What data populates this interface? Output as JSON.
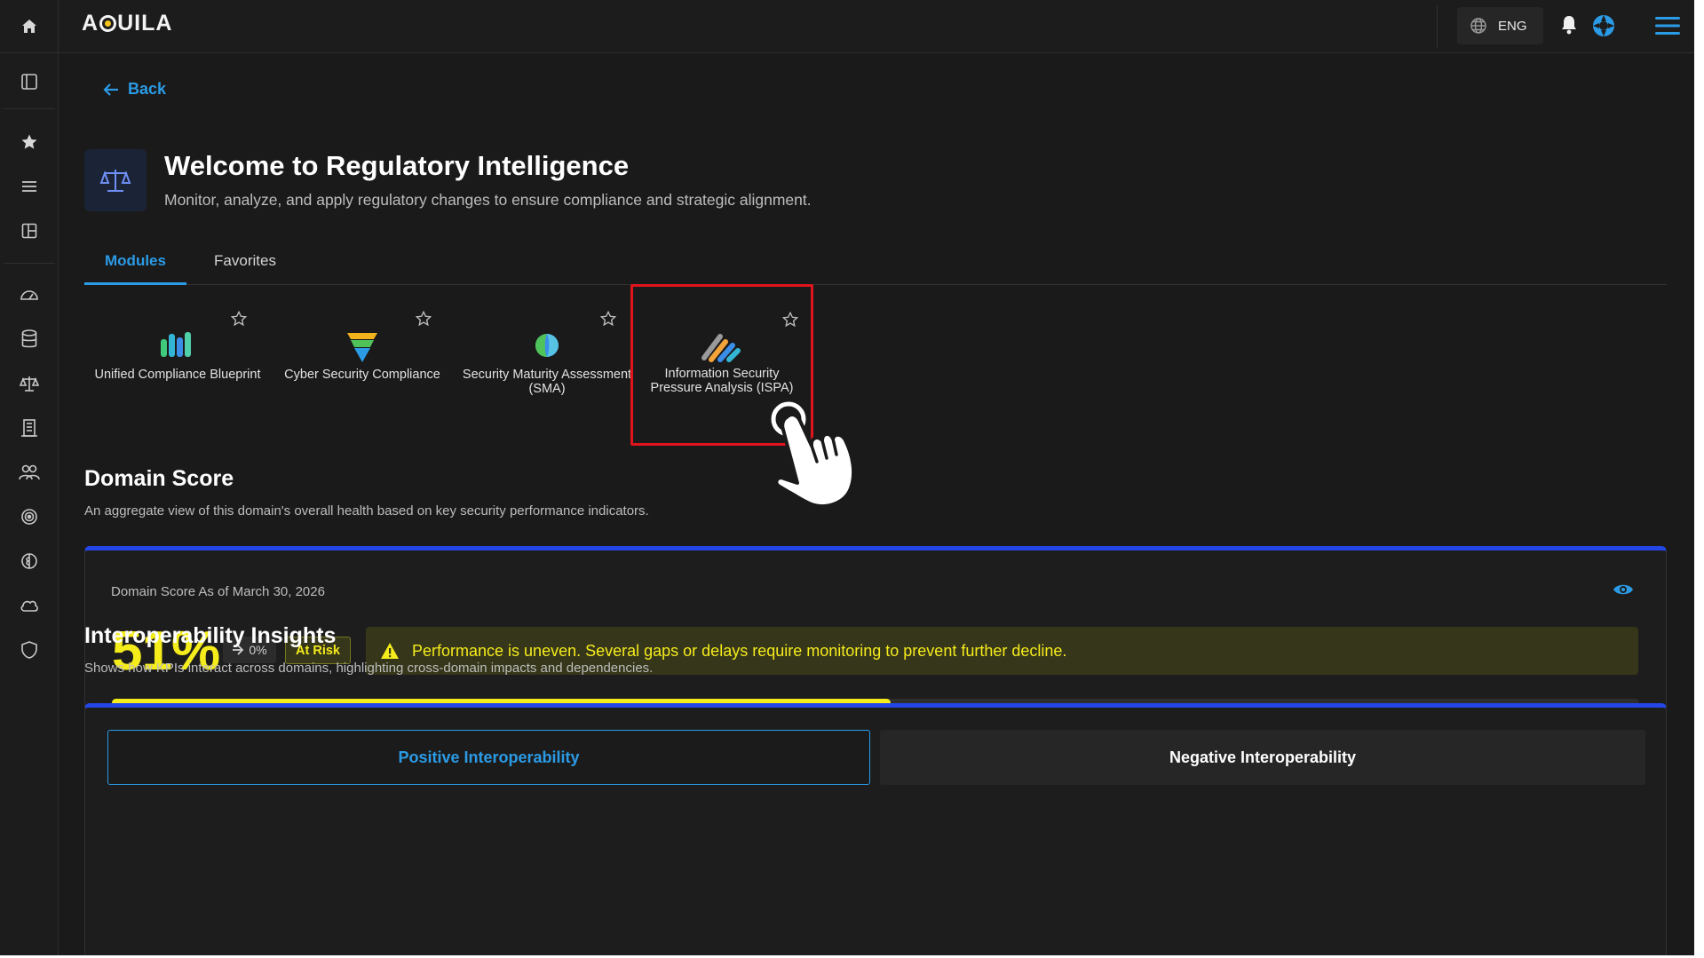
{
  "app": {
    "logo": "AQUILA",
    "logo_prefix": "A",
    "logo_suffix": "UILA"
  },
  "topbar": {
    "language": "ENG"
  },
  "nav": {
    "back_label": "Back"
  },
  "hero": {
    "title": "Welcome to Regulatory Intelligence",
    "subtitle": "Monitor, analyze, and apply regulatory changes to ensure compliance and strategic alignment."
  },
  "tabs": [
    {
      "label": "Modules",
      "active": true
    },
    {
      "label": "Favorites",
      "active": false
    }
  ],
  "modules": [
    {
      "label": "Unified Compliance Blueprint",
      "icon": "bars-chart-icon"
    },
    {
      "label": "Cyber Security Compliance",
      "icon": "layered-shield-icon"
    },
    {
      "label": "Security Maturity Assessment (SMA)",
      "icon": "leaf-globe-icon"
    },
    {
      "label": "Information Security Pressure Analysis (ISPA)",
      "icon": "diagonal-stripes-icon",
      "highlighted": true
    }
  ],
  "domain_score": {
    "title": "Domain Score",
    "subtitle": "An aggregate view of this domain's overall health based on key security performance indicators.",
    "as_of": "Domain Score As of March 30, 2026",
    "score": "51%",
    "score_value": 0.51,
    "delta": "0%",
    "status": "At Risk",
    "alert": "Performance is uneven. Several gaps or delays require monitoring to prevent further decline.",
    "progress": 0.51
  },
  "interoperability": {
    "title": "Interoperability Insights",
    "subtitle": "Shows how KPIs interact across domains, highlighting cross-domain impacts and dependencies.",
    "positive_label": "Positive Interoperability",
    "negative_label": "Negative Interoperability"
  },
  "colors": {
    "accent": "#2b9be6",
    "warning": "#f5ec1c",
    "card_top": "#2546e6",
    "highlight": "#e0141c"
  }
}
